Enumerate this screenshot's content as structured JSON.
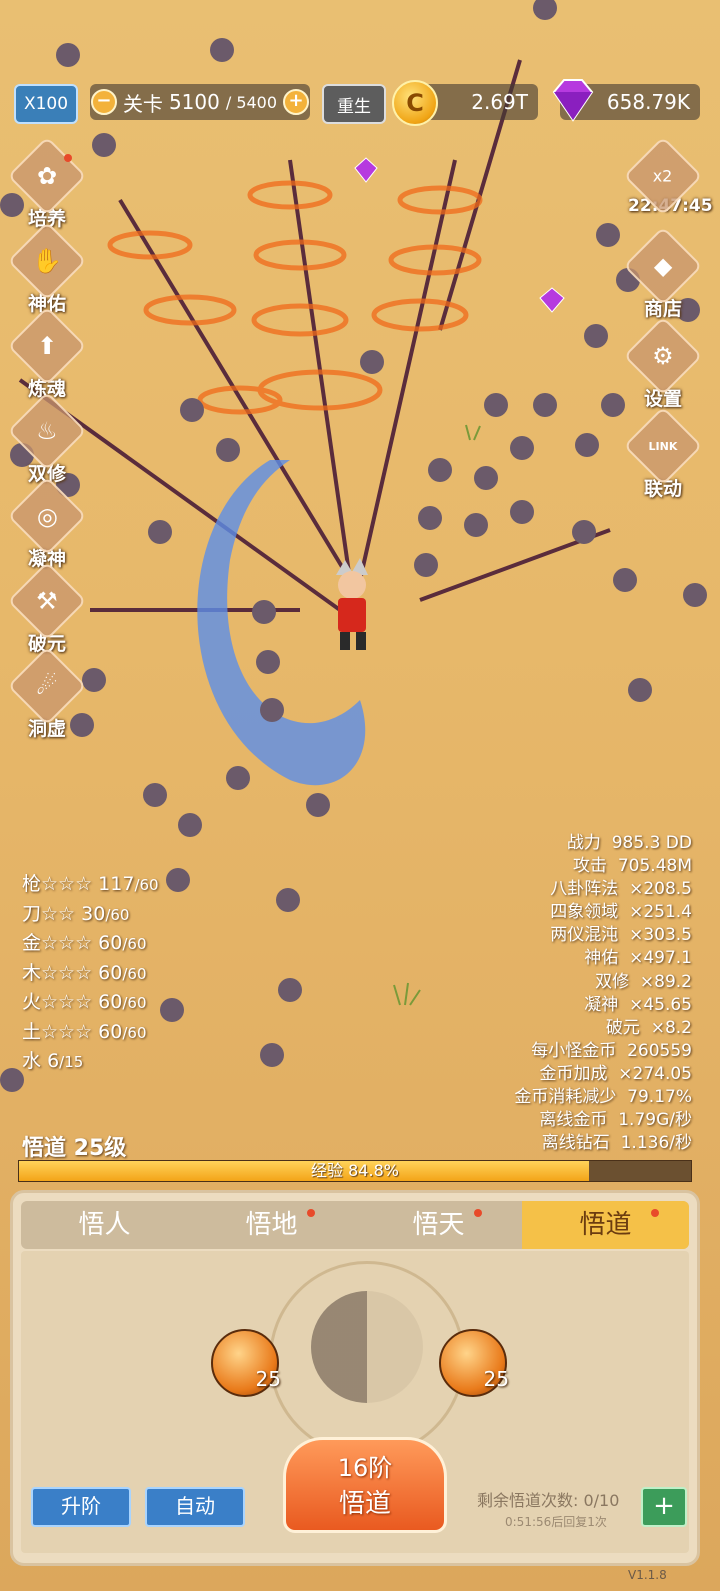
{
  "top_bar": {
    "speed": "X100",
    "stage_label": "关卡",
    "stage_current": "5100",
    "stage_total": "/ 5400",
    "minus": "−",
    "plus": "+",
    "rebirth": "重生",
    "coin_symbol": "C",
    "coins": "2.69T",
    "gems": "658.79K"
  },
  "left_menu": [
    {
      "label": "培养",
      "icon": "leaf-icon",
      "glyph": "✿"
    },
    {
      "label": "神佑",
      "icon": "hands-icon",
      "glyph": "✋"
    },
    {
      "label": "炼魂",
      "icon": "arrow-up-icon",
      "glyph": "⬆"
    },
    {
      "label": "双修",
      "icon": "flame-icon",
      "glyph": "♨"
    },
    {
      "label": "凝神",
      "icon": "focus-icon",
      "glyph": "◎"
    },
    {
      "label": "破元",
      "icon": "hammer-icon",
      "glyph": "⚒"
    },
    {
      "label": "洞虚",
      "icon": "fire-icon",
      "glyph": "☄"
    }
  ],
  "right_menu": {
    "boost_label": "x2",
    "timer": "22:47:45",
    "shop": "商店",
    "settings": "设置",
    "link": "联动",
    "link_glyph": "LINK"
  },
  "weapon_stats": [
    {
      "name": "枪",
      "stars": "☆☆☆",
      "value": "117",
      "max": "/60"
    },
    {
      "name": "刀",
      "stars": "☆☆",
      "value": "30",
      "max": "/60"
    },
    {
      "name": "金",
      "stars": "☆☆☆",
      "value": "60",
      "max": "/60"
    },
    {
      "name": "木",
      "stars": "☆☆☆",
      "value": "60",
      "max": "/60"
    },
    {
      "name": "火",
      "stars": "☆☆☆",
      "value": "60",
      "max": "/60"
    },
    {
      "name": "土",
      "stars": "☆☆☆",
      "value": "60",
      "max": "/60"
    },
    {
      "name": "水",
      "stars": "",
      "value": "6",
      "max": "/15"
    }
  ],
  "combat_stats": [
    {
      "label": "战力",
      "value": "985.3 DD"
    },
    {
      "label": "攻击",
      "value": "705.48M"
    },
    {
      "label": "八卦阵法",
      "value": "×208.5"
    },
    {
      "label": "四象领域",
      "value": "×251.4"
    },
    {
      "label": "两仪混沌",
      "value": "×303.5"
    },
    {
      "label": "神佑",
      "value": "×497.1"
    },
    {
      "label": "双修",
      "value": "×89.2"
    },
    {
      "label": "凝神",
      "value": "×45.65"
    },
    {
      "label": "破元",
      "value": "×8.2"
    },
    {
      "label": "每小怪金币",
      "value": "260559"
    },
    {
      "label": "金币加成",
      "value": "×274.05"
    },
    {
      "label": "金币消耗减少",
      "value": "79.17%"
    },
    {
      "label": "离线金币",
      "value": "1.79G/秒"
    },
    {
      "label": "离线钻石",
      "value": "1.136/秒"
    }
  ],
  "level": {
    "title": "悟道 25级",
    "exp_label": "经验 84.8%",
    "progress": 0.848
  },
  "panel": {
    "tabs": [
      "悟人",
      "悟地",
      "悟天",
      "悟道"
    ],
    "active_tab": 3,
    "orb_left_value": "25",
    "orb_right_value": "25",
    "main_button_line1": "16阶",
    "main_button_line2": "悟道",
    "upgrade": "升阶",
    "auto": "自动",
    "remaining": "剩余悟道次数: 0/10",
    "regen": "0:51:56后回复1次",
    "add": "+"
  },
  "version": "V1.1.8",
  "colors": {
    "accent_orange": "#e95a20",
    "button_blue": "#3a7fc8",
    "tab_active": "#f5c148",
    "gem_purple": "#b63adf"
  }
}
